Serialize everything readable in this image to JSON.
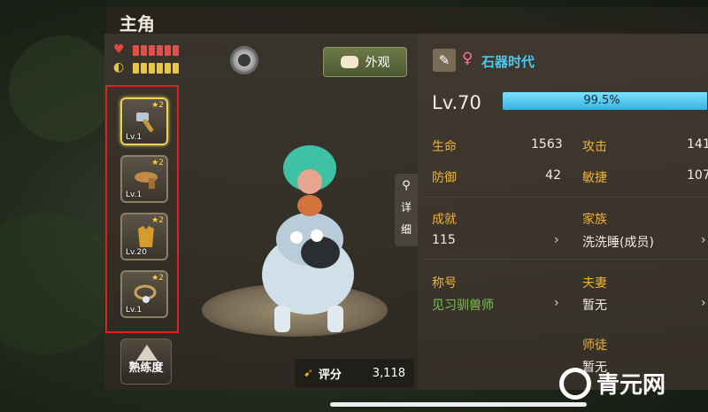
{
  "header": {
    "title": "主角"
  },
  "status": {
    "hp_segments_full": 6,
    "hp_segments_total": 12,
    "energy_segments_full": 6,
    "energy_segments_total": 12
  },
  "equipment": [
    {
      "level": "Lv.1",
      "stars": "2",
      "icon": "hammer-icon"
    },
    {
      "level": "Lv.1",
      "stars": "2",
      "icon": "belt-icon"
    },
    {
      "level": "Lv.20",
      "stars": "2",
      "icon": "armor-icon"
    },
    {
      "level": "Lv.1",
      "stars": "2",
      "icon": "necklace-icon"
    }
  ],
  "mastery": {
    "label": "熟练度"
  },
  "appearance": {
    "label": "外观"
  },
  "detail_tab": {
    "label_1": "详",
    "label_2": "细"
  },
  "score": {
    "label": "评分",
    "value": "3,118"
  },
  "character": {
    "name": "石器时代",
    "level": "Lv.70",
    "exp_text": "99.5%",
    "exp_fraction": 0.995
  },
  "stats": {
    "hp_label": "生命",
    "hp_value": "1563",
    "atk_label": "攻击",
    "atk_value": "141",
    "def_label": "防御",
    "def_value": "42",
    "agi_label": "敏捷",
    "agi_value": "107",
    "achieve_label": "成就",
    "achieve_value": "115",
    "family_label": "家族",
    "family_value": "洗洗睡(成员)",
    "title_label": "称号",
    "title_value": "见习驯兽师",
    "spouse_label": "夫妻",
    "spouse_value": "暂无",
    "mentor_label": "师徒",
    "mentor_value": "暂无"
  },
  "watermark": {
    "text": "青元网"
  },
  "colors": {
    "accent_blue": "#48c9f0",
    "key_orange": "#f0b13a",
    "title_green": "#7fc451"
  }
}
